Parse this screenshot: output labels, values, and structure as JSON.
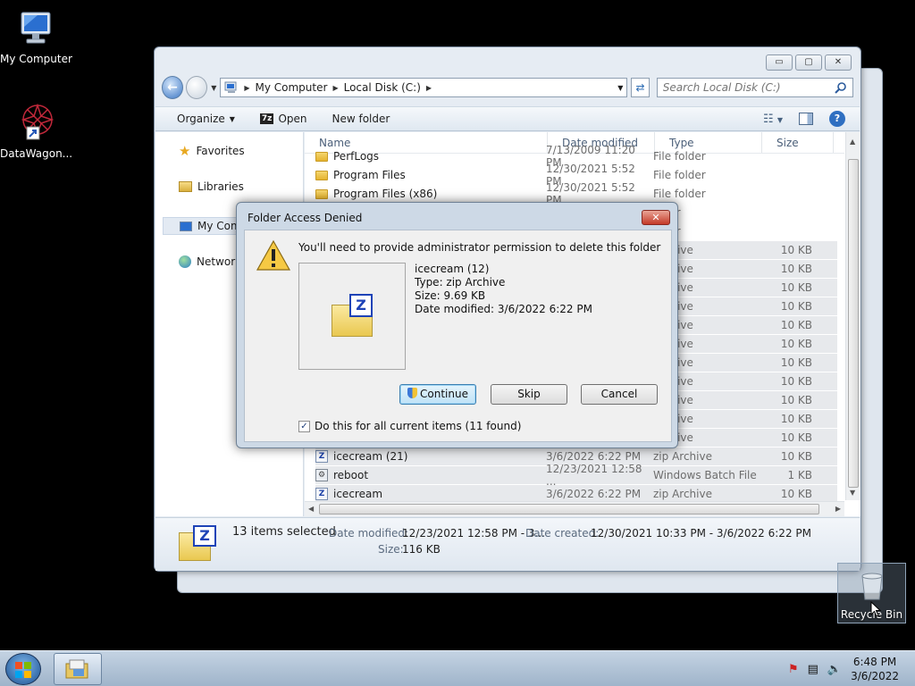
{
  "desktop": {
    "icons": [
      {
        "label": "My Computer"
      },
      {
        "label": "DataWagon..."
      }
    ],
    "recycle_bin": {
      "label": "Recycle Bin"
    }
  },
  "explorer": {
    "window_controls": {
      "minimize": "▭",
      "maximize": "▢",
      "close": "✕"
    },
    "address": {
      "crumbs": [
        "My Computer",
        "Local Disk (C:)"
      ]
    },
    "search": {
      "placeholder": "Search Local Disk (C:)"
    },
    "toolbar": {
      "organize": "Organize",
      "open": "Open",
      "open_icon_text": "7z",
      "new_folder": "New folder"
    },
    "nav": {
      "favorites": "Favorites",
      "libraries": "Libraries",
      "my_computer": "My Com",
      "network": "Network"
    },
    "columns": {
      "name": "Name",
      "date": "Date modified",
      "type": "Type",
      "size": "Size"
    },
    "rows": [
      {
        "name": "PerfLogs",
        "date": "7/13/2009 11:20 PM",
        "type": "File folder",
        "size": "",
        "kind": "folder"
      },
      {
        "name": "Program Files",
        "date": "12/30/2021 5:52 PM",
        "type": "File folder",
        "size": "",
        "kind": "folder"
      },
      {
        "name": "Program Files (x86)",
        "date": "12/30/2021 5:52 PM",
        "type": "File folder",
        "size": "",
        "kind": "folder"
      },
      {
        "name": "",
        "date": "",
        "type": "older",
        "size": "",
        "kind": "folder"
      },
      {
        "name": "",
        "date": "",
        "type": "older",
        "size": "",
        "kind": "folder"
      },
      {
        "name": "",
        "date": "",
        "type": "Archive",
        "size": "10 KB",
        "kind": "zip"
      },
      {
        "name": "",
        "date": "",
        "type": "Archive",
        "size": "10 KB",
        "kind": "zip"
      },
      {
        "name": "",
        "date": "",
        "type": "Archive",
        "size": "10 KB",
        "kind": "zip"
      },
      {
        "name": "",
        "date": "",
        "type": "Archive",
        "size": "10 KB",
        "kind": "zip"
      },
      {
        "name": "",
        "date": "",
        "type": "Archive",
        "size": "10 KB",
        "kind": "zip"
      },
      {
        "name": "",
        "date": "",
        "type": "Archive",
        "size": "10 KB",
        "kind": "zip"
      },
      {
        "name": "",
        "date": "",
        "type": "Archive",
        "size": "10 KB",
        "kind": "zip"
      },
      {
        "name": "",
        "date": "",
        "type": "Archive",
        "size": "10 KB",
        "kind": "zip"
      },
      {
        "name": "",
        "date": "",
        "type": "Archive",
        "size": "10 KB",
        "kind": "zip"
      },
      {
        "name": "",
        "date": "",
        "type": "Archive",
        "size": "10 KB",
        "kind": "zip"
      },
      {
        "name": "",
        "date": "",
        "type": "Archive",
        "size": "10 KB",
        "kind": "zip"
      },
      {
        "name": "icecream (21)",
        "date": "3/6/2022 6:22 PM",
        "type": "zip Archive",
        "size": "10 KB",
        "kind": "zip"
      },
      {
        "name": "reboot",
        "date": "12/23/2021 12:58 ...",
        "type": "Windows Batch File",
        "size": "1 KB",
        "kind": "bat"
      },
      {
        "name": "icecream",
        "date": "3/6/2022 6:22 PM",
        "type": "zip Archive",
        "size": "10 KB",
        "kind": "zip"
      }
    ],
    "details": {
      "selected": "13 items selected",
      "date_modified_label": "Date modified:",
      "date_modified": "12/23/2021 12:58 PM - 3...",
      "date_created_label": "Date created:",
      "date_created": "12/30/2021 10:33 PM - 3/6/2022 6:22 PM",
      "size_label": "Size:",
      "size": "116 KB"
    }
  },
  "dialog": {
    "title": "Folder Access Denied",
    "close": "✕",
    "message": "You'll need to provide administrator permission to delete this folder",
    "file": {
      "name": "icecream (12)",
      "type": "Type: zip Archive",
      "size": "Size: 9.69 KB",
      "modified": "Date modified: 3/6/2022 6:22 PM"
    },
    "buttons": {
      "continue": "Continue",
      "skip": "Skip",
      "cancel": "Cancel"
    },
    "checkbox": {
      "label": "Do this for all current items (11 found)",
      "checked": true
    }
  },
  "taskbar": {
    "time": "6:48 PM",
    "date": "3/6/2022"
  },
  "colors": {
    "accent": "#3b76c4",
    "selection": "#e7e9ec",
    "close_red": "#c43a28"
  }
}
